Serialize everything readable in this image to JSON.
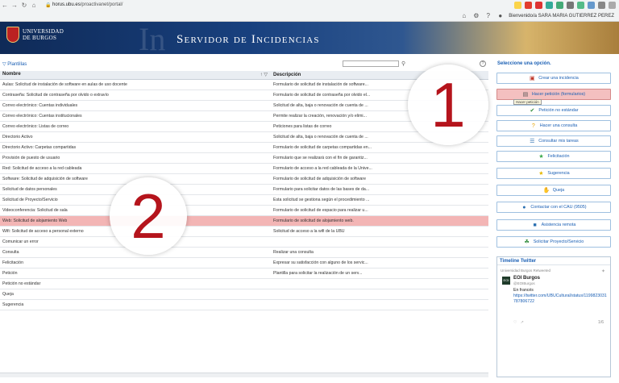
{
  "browser": {
    "url_host": "horus.ubu.es",
    "url_path": "/proactivanet/portal/",
    "greeting": "Bienvenido/a SARA MARIA GUTIERREZ PEREZ"
  },
  "banner": {
    "university_line1": "UNIVERSIDAD",
    "university_line2": "DE BURGOS",
    "big_letters": "In",
    "title": "Servidor de Incidencias"
  },
  "left": {
    "filter_label": "Plantillas",
    "col_name": "Nombre",
    "col_desc": "Descripción",
    "rows": [
      {
        "name": "Aulas: Solicitud de instalación de software en aulas de uso docente",
        "desc": "Formulario de solicitud de instalación de software..."
      },
      {
        "name": "Contraseña: Solicitud de contraseña por olvido o extravío",
        "desc": "Formulario de solicitud de contraseña por olvido el..."
      },
      {
        "name": "Correo electrónico: Cuentas individuales",
        "desc": "Solicitud de alta, baja o renovación de cuenta de ..."
      },
      {
        "name": "Correo electrónico: Cuentas institucionales",
        "desc": "Permite realizar la creación, renovación y/o elimi..."
      },
      {
        "name": "Correo electrónico: Listas de correo",
        "desc": "Peticiones para listas de correo"
      },
      {
        "name": "Directorio Activo",
        "desc": "Solicitud de alta, baja o renovación de cuenta de ..."
      },
      {
        "name": "Directorio Activo: Carpetas compartidas",
        "desc": "Formulario de solicitud de carpetas compartidas en..."
      },
      {
        "name": "Provisión de puesto de usuario",
        "desc": "Formulario que se realizará con el fin de garantiz..."
      },
      {
        "name": "Red: Solicitud de acceso a la red cableada",
        "desc": "Formulario de acceso a la red cableada de la Unive..."
      },
      {
        "name": "Software: Solicitud de adquisición de software",
        "desc": "Formulario de solicitud de adquisición de software"
      },
      {
        "name": "Solicitud de datos personales",
        "desc": "Formulario para solicitar datos de las bases de da..."
      },
      {
        "name": "Solicitud de Proyecto/Servicio",
        "desc": "Esta solicitud se gestiona según el procedimiento ..."
      },
      {
        "name": "Videoconferencia: Solicitud de sala",
        "desc": "Formulario de solicitud de espacio para realizar u..."
      },
      {
        "name": "Web: Solicitud de alojamiento Web",
        "desc": "Formulario de solicitud de alojamiento web."
      },
      {
        "name": "Wifi: Solicitud de acceso a personal externo",
        "desc": "Solicitud de acceso a la wifi de la UBU"
      },
      {
        "name": "Comunicar un error",
        "desc": ""
      },
      {
        "name": "Consulta",
        "desc": "Realizar una consulta"
      },
      {
        "name": "Felicitación",
        "desc": "Expresar su satisfacción con alguno de los servic..."
      },
      {
        "name": "Petición",
        "desc": "Plantilla para solicitar la realización de un serv..."
      },
      {
        "name": "Petición no estándar",
        "desc": ""
      },
      {
        "name": "Queja",
        "desc": ""
      },
      {
        "name": "Sugerencia",
        "desc": ""
      }
    ]
  },
  "annotations": {
    "one": "1",
    "two": "2"
  },
  "right": {
    "heading": "Seleccione una opción.",
    "options": [
      {
        "label": "Crear una incidencia",
        "icon": "alert-icon",
        "color": "#c0392b"
      },
      {
        "label": "Hacer petición (formularios)",
        "icon": "form-icon",
        "color": "#555555"
      },
      {
        "label": "Petición no estándar",
        "icon": "check-icon",
        "color": "#2e8b3a"
      },
      {
        "label": "Hacer una consulta",
        "icon": "question-icon",
        "color": "#e6a300"
      },
      {
        "label": "Consultar mis tareas",
        "icon": "list-icon",
        "color": "#2a6fb0"
      },
      {
        "label": "Felicitación",
        "icon": "star-icon",
        "color": "#3aa84a"
      },
      {
        "label": "Sugerencia",
        "icon": "star-icon",
        "color": "#e6b800"
      },
      {
        "label": "Queja",
        "icon": "hand-icon",
        "color": "#c0392b"
      },
      {
        "label": "Contactar con el CAU (9505)",
        "icon": "person-icon",
        "color": "#2a6fb0"
      },
      {
        "label": "Asistencia remota",
        "icon": "monitor-icon",
        "color": "#2a6fb0"
      },
      {
        "label": "Solicitar Proyecto/Servicio",
        "icon": "leaf-icon",
        "color": "#2e8b3a"
      }
    ],
    "tooltip": "Hacer petición"
  },
  "twitter": {
    "title": "Timeline Twitter",
    "retweet": "Universidad Burgos Retweeted",
    "name": "EOI Burgos",
    "handle": "@EOIBurgos",
    "text": "En francés",
    "link": "https://twitter.com/UBUCultural/status/1199823031787806722",
    "count": "1/6"
  }
}
